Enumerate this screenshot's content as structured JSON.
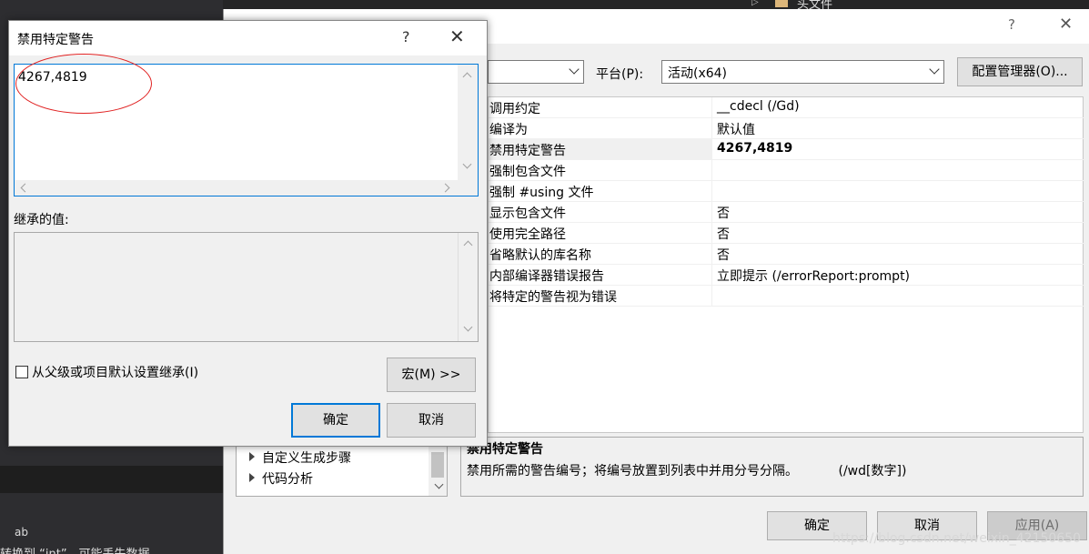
{
  "ide": {
    "tree_item": "头文件",
    "error_text": "转换到 “int”，可能丢失数据",
    "icon_label": "ab"
  },
  "property_dialog": {
    "help": "?",
    "close": "✕",
    "platform_label": "平台(P):",
    "platform_value": "活动(x64)",
    "config_manager": "配置管理器(O)...",
    "properties": [
      {
        "name": "调用约定",
        "value": "__cdecl (/Gd)"
      },
      {
        "name": "编译为",
        "value": "默认值"
      },
      {
        "name": "禁用特定警告",
        "value": "4267,4819"
      },
      {
        "name": "强制包含文件",
        "value": ""
      },
      {
        "name": "强制 #using 文件",
        "value": ""
      },
      {
        "name": "显示包含文件",
        "value": "否"
      },
      {
        "name": "使用完全路径",
        "value": "否"
      },
      {
        "name": "省略默认的库名称",
        "value": "否"
      },
      {
        "name": "内部编译器错误报告",
        "value": "立即提示 (/errorReport:prompt)"
      },
      {
        "name": "将特定的警告视为错误",
        "value": ""
      }
    ],
    "tree_items": [
      "自定义生成步骤",
      "代码分析"
    ],
    "description_title": "禁用特定警告",
    "description_text": "禁用所需的警告编号；将编号放置到列表中并用分号分隔。          (/wd[数字])",
    "ok": "确定",
    "cancel": "取消",
    "apply": "应用(A)"
  },
  "warning_dialog": {
    "title": "禁用特定警告",
    "help": "?",
    "close": "✕",
    "value": "4267,4819",
    "inherited_label": "继承的值:",
    "inherit_checkbox": "从父级或项目默认设置继承(I)",
    "macro_button": "宏(M) >>",
    "ok": "确定",
    "cancel": "取消"
  },
  "watermark": "https://blog.csdn.net/weixin_42150650",
  "colors": {
    "accent": "#0078d7",
    "annotation": "#e02020"
  }
}
